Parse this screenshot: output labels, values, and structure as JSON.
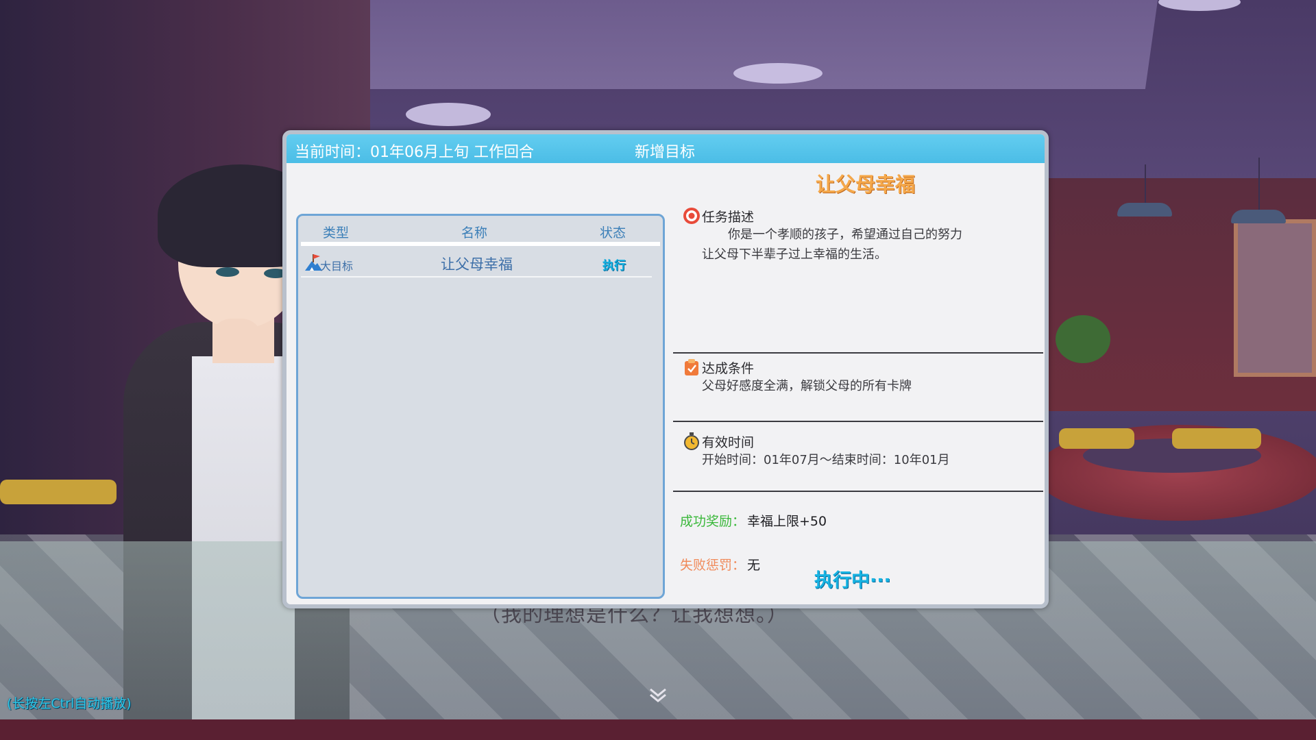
{
  "modal": {
    "current_time_label": "当前时间：",
    "current_time_value": "01年06月上旬 工作回合",
    "title": "新增目标"
  },
  "goal_list": {
    "columns": [
      "类型",
      "名称",
      "状态"
    ],
    "rows": [
      {
        "type": "大目标",
        "name": "让父母幸福",
        "status": "执行",
        "icon": "flag-mountain-icon"
      }
    ]
  },
  "detail": {
    "title": "让父母幸福",
    "description": {
      "heading": "任务描述",
      "line1": "你是一个孝顺的孩子，希望通过自己的努力",
      "line2": "让父母下半辈子过上幸福的生活。",
      "icon": "target-icon"
    },
    "condition": {
      "heading": "达成条件",
      "text": "父母好感度全满，解锁父母的所有卡牌",
      "icon": "clipboard-check-icon"
    },
    "valid_time": {
      "heading": "有效时间",
      "text": "开始时间：01年07月～结束时间：10年01月",
      "icon": "stopwatch-icon"
    },
    "success_reward": {
      "label": "成功奖励：",
      "value": "幸福上限+50",
      "color": "#3bb83b"
    },
    "failure_penalty": {
      "label": "失败惩罚：",
      "value": "无",
      "color": "#f08a5a"
    },
    "status_text": "执行中···"
  },
  "dialogue": {
    "text": "（我的理想是什么？让我想想。）",
    "hint": "(长按左Ctrl自动播放)"
  },
  "colors": {
    "header_bg": "#4bbde6",
    "accent_blue": "#17b3e2",
    "title_orange": "#f5a84a",
    "list_border": "#6ea5d6"
  }
}
